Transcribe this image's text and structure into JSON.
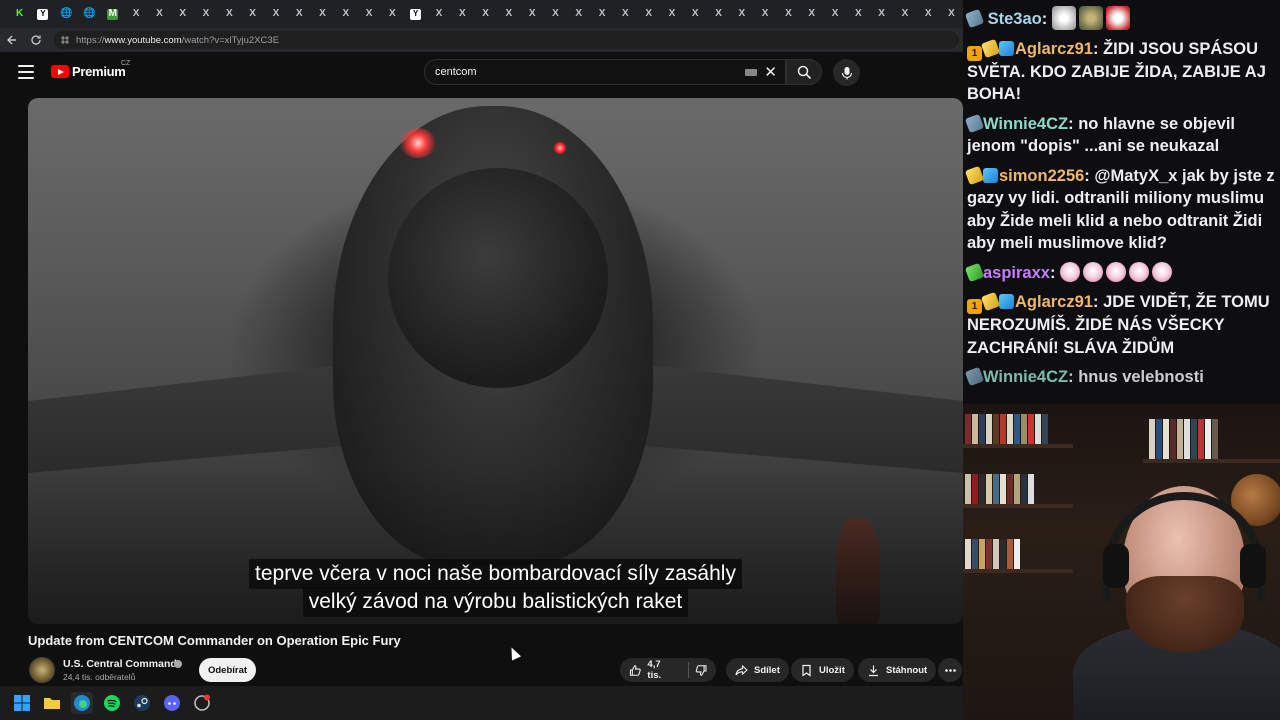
{
  "browser": {
    "tabs": [
      "K",
      "Y",
      "🌐",
      "🌐",
      "M",
      "X",
      "X",
      "X",
      "X",
      "X",
      "X",
      "X",
      "X",
      "X",
      "X",
      "X",
      "X",
      "Y",
      "X",
      "X",
      "X",
      "X",
      "X",
      "X",
      "X",
      "X",
      "X",
      "X",
      "X",
      "X",
      "X",
      "X",
      "X",
      "X",
      "X",
      "X",
      "X",
      "X",
      "X",
      "X",
      "X"
    ],
    "url_prefix": "https://",
    "url_host": "www.youtube.com",
    "url_path": "/watch?v=xlTyju2XC3E"
  },
  "youtube": {
    "logo_text": "Premium",
    "country": "CZ",
    "search_value": "centcom",
    "subtitle_line1": "teprve včera v noci naše bombardovací síly zasáhly",
    "subtitle_line2": "velký závod na výrobu balistických raket",
    "video_title": "Update from CENTCOM Commander on Operation Epic Fury",
    "channel_name": "U.S. Central Command",
    "subscriber_count": "24,4 tis. odběratelů",
    "subscribe_label": "Odebírat",
    "like_count": "4,7 tis.",
    "share_label": "Sdílet",
    "save_label": "Uložit",
    "download_label": "Stáhnout",
    "accent_color": "#ff0000"
  },
  "chat": {
    "messages": [
      {
        "user": "Ste3ao",
        "user_color": "#a9d4ee",
        "text": ""
      },
      {
        "user": "Aglarcz91",
        "user_color": "#f0b768",
        "text": "ŽIDI JSOU SPÁSOU SVĚTA. KDO ZABIJE ŽIDA, ZABIJE AJ BOHA!"
      },
      {
        "user": "Winnie4CZ",
        "user_color": "#8fd9c9",
        "text": "no hlavne se objevil jenom \"dopis\" ...ani se neukazal"
      },
      {
        "user": "simon2256",
        "user_color": "#f0b768",
        "text": "@MatyX_x jak by jste z gazy vy lidi. odtranili miliony muslimu aby Žide meli klid a nebo odtranit Židi aby meli muslimove klid?"
      },
      {
        "user": "aspiraxx",
        "user_color": "#c77dff",
        "text": ""
      },
      {
        "user": "Aglarcz91",
        "user_color": "#f0b768",
        "text": "JDE VIDĚT, ŽE TOMU NEROZUMÍŠ. ŽIDÉ NÁS VŠECKY ZACHRÁNÍ! SLÁVA ŽIDŮM"
      },
      {
        "user": "Winnie4CZ",
        "user_color": "#8fd9c9",
        "text": "hnus velebnosti"
      }
    ]
  }
}
